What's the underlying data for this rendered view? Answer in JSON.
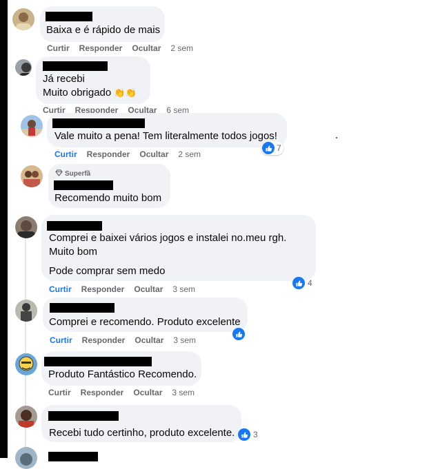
{
  "actions": {
    "like": "Curtir",
    "reply": "Responder",
    "hide": "Ocultar"
  },
  "comments": [
    {
      "text": [
        "Baixa e é rápido de mais"
      ],
      "time": "2 sem"
    },
    {
      "text": [
        "Já recebi",
        "Muito obrigado"
      ],
      "emoji": "👏👏",
      "time": "6 sem"
    },
    {
      "text": [
        "Vale muito a pena! Tem literalmente todos jogos!"
      ],
      "time": "2 sem",
      "reactions": "7"
    },
    {
      "badge": "Superfã",
      "text": [
        "Recomendo muito bom"
      ]
    },
    {
      "text": [
        "Comprei e baixei vários jogos e instalei no.meu rgh.",
        "Muito bom",
        "Pode comprar sem medo"
      ],
      "time": "3 sem",
      "reactions": "4"
    },
    {
      "text": [
        "Comprei e recomendo. Produto excelente"
      ],
      "time": "3 sem"
    },
    {
      "text": [
        "Produto Fantástico Recomendo."
      ],
      "time": "3 sem"
    },
    {
      "text": [
        "Recebi tudo certinho, produto excelente."
      ],
      "reactions": "3"
    }
  ],
  "colors": {
    "bubble": "#f0f2f5",
    "action_text": "#65676b",
    "link": "#1877f2",
    "redaction": "#000000"
  }
}
